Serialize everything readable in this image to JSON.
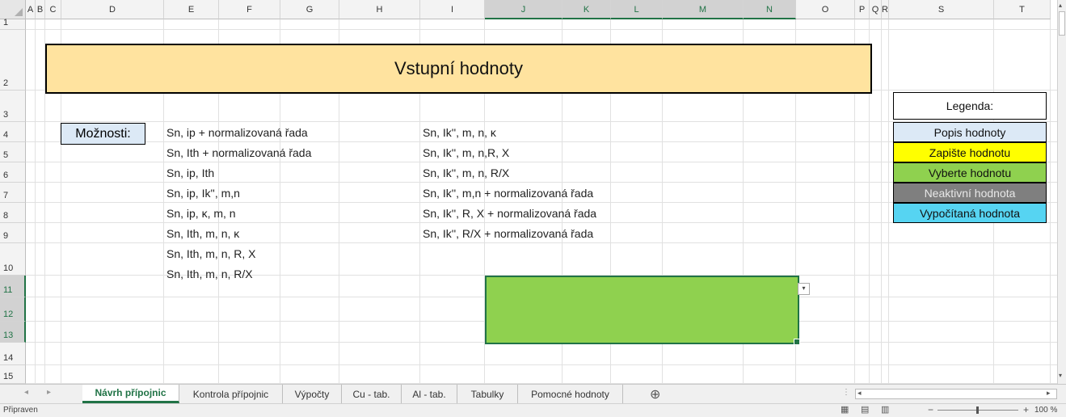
{
  "columns": [
    "A",
    "B",
    "C",
    "D",
    "E",
    "F",
    "G",
    "H",
    "I",
    "J",
    "K",
    "L",
    "M",
    "N",
    "O",
    "P",
    "Q",
    "R",
    "S",
    "T"
  ],
  "selected_columns": [
    "J",
    "K",
    "L",
    "M",
    "N"
  ],
  "rows": [
    "1",
    "2",
    "3",
    "4",
    "5",
    "6",
    "7",
    "8",
    "9",
    "10",
    "11",
    "12",
    "13",
    "14",
    "15"
  ],
  "selected_rows": [
    "11",
    "12",
    "13"
  ],
  "title": "Vstupní hodnoty",
  "moznosti_label": "Možnosti:",
  "options_left": [
    "Sn, ip + normalizovaná řada",
    "Sn, Ith + normalizovaná řada",
    "Sn, ip, Ith",
    "Sn, ip, Ik'', m,n",
    "Sn, ip, κ, m, n",
    "Sn, Ith, m, n, κ",
    "Sn, Ith, m, n, R, X",
    "Sn, Ith, m, n, R/X"
  ],
  "options_right": [
    "Sn, Ik'', m, n, κ",
    "Sn, Ik'', m, n,R, X",
    "Sn, Ik'', m, n, R/X",
    "Sn, Ik'', m,n + normalizovaná řada",
    "Sn, Ik'', R, X + normalizovaná řada",
    "Sn, Ik'', R/X + normalizovaná řada"
  ],
  "dropdown_icon": "▾",
  "legend": {
    "title": "Legenda:",
    "items": [
      {
        "label": "Popis hodnoty",
        "bg": "#dce9f6",
        "fg": "#111111"
      },
      {
        "label": "Zapište hodnotu",
        "bg": "#ffff00",
        "fg": "#111111"
      },
      {
        "label": "Vyberte hodnotu",
        "bg": "#8fd14f",
        "fg": "#111111"
      },
      {
        "label": "Neaktivní hodnota",
        "bg": "#7f7f7f",
        "fg": "#e8e8e8"
      },
      {
        "label": "Vypočítaná hodnota",
        "bg": "#56d4f2",
        "fg": "#111111"
      }
    ]
  },
  "input_cell_color": "#8fd14f",
  "accent_color": "#217346",
  "sheet_tabs": [
    "Návrh přípojnic",
    "Kontrola přípojnic",
    "Výpočty",
    "Cu - tab.",
    "Al - tab.",
    "Tabulky",
    "Pomocné hodnoty"
  ],
  "active_tab": "Návrh přípojnic",
  "add_sheet_icon": "⊕",
  "status": {
    "text": "Připraven",
    "zoom": "100 %"
  }
}
